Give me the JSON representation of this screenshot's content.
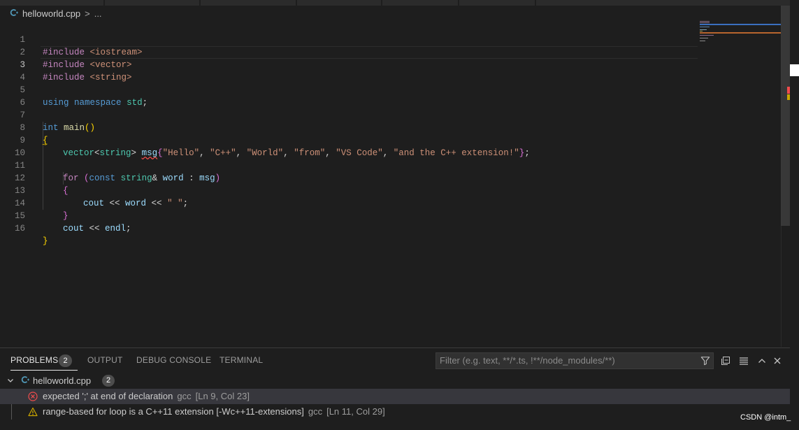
{
  "breadcrumb": {
    "file": "helloworld.cpp",
    "separator": ">",
    "more": "..."
  },
  "editor": {
    "lines": [
      {
        "n": "1"
      },
      {
        "n": "2"
      },
      {
        "n": "3"
      },
      {
        "n": "4"
      },
      {
        "n": "5"
      },
      {
        "n": "6"
      },
      {
        "n": "7"
      },
      {
        "n": "8"
      },
      {
        "n": "9"
      },
      {
        "n": "10"
      },
      {
        "n": "11"
      },
      {
        "n": "12"
      },
      {
        "n": "13"
      },
      {
        "n": "14"
      },
      {
        "n": "15"
      },
      {
        "n": "16"
      }
    ],
    "code": {
      "l1_kw": "#include",
      "l1_hdr": "<iostream>",
      "l2_kw": "#include",
      "l2_hdr": "<vector>",
      "l3_kw": "#include",
      "l3_hdr": "<string>",
      "l5_using": "using",
      "l5_namespace": "namespace",
      "l5_std": "std",
      "l5_semi": ";",
      "l7_int": "int",
      "l7_main": "main",
      "l7_parens": "()",
      "l8_brace": "{",
      "l9_vector": "vector",
      "l9_lt": "<",
      "l9_string": "string",
      "l9_gt": ">",
      "l9_msg": "msg",
      "l9_open": "{",
      "l9_s1": "\"Hello\"",
      "l9_s2": "\"C++\"",
      "l9_s3": "\"World\"",
      "l9_s4": "\"from\"",
      "l9_s5": "\"VS Code\"",
      "l9_s6": "\"and the C++ extension!\"",
      "l9_comma": ", ",
      "l9_close": "}",
      "l9_semi": ";",
      "l11_for": "for",
      "l11_open": "(",
      "l11_const": "const",
      "l11_string": "string",
      "l11_amp": "&",
      "l11_word": "word",
      "l11_colon": " : ",
      "l11_msg": "msg",
      "l11_close": ")",
      "l12_brace": "{",
      "l13_cout": "cout",
      "l13_op1": " << ",
      "l13_word": "word",
      "l13_op2": " << ",
      "l13_str": "\" \"",
      "l13_semi": ";",
      "l14_brace": "}",
      "l15_cout": "cout",
      "l15_op": " << ",
      "l15_endl": "endl",
      "l15_semi": ";",
      "l16_brace": "}"
    }
  },
  "panel": {
    "tabs": [
      {
        "label": "PROBLEMS"
      },
      {
        "label": "OUTPUT"
      },
      {
        "label": "DEBUG CONSOLE"
      },
      {
        "label": "TERMINAL"
      }
    ],
    "problems_count": "2",
    "filter_placeholder": "Filter (e.g. text, **/*.ts, !**/node_modules/**)",
    "file": {
      "name": "helloworld.cpp",
      "count": "2"
    },
    "problems": [
      {
        "message": "expected ';' at end of declaration",
        "source": "gcc",
        "position": "[Ln 9, Col 23]",
        "severity": "error"
      },
      {
        "message": "range-based for loop is a C++11 extension [-Wc++11-extensions]",
        "source": "gcc",
        "position": "[Ln 11, Col 29]",
        "severity": "warning"
      }
    ]
  },
  "watermark": "CSDN @intm_",
  "colors": {
    "error": "#f14c4c",
    "warning": "#cca700",
    "accent": "#519aba"
  }
}
